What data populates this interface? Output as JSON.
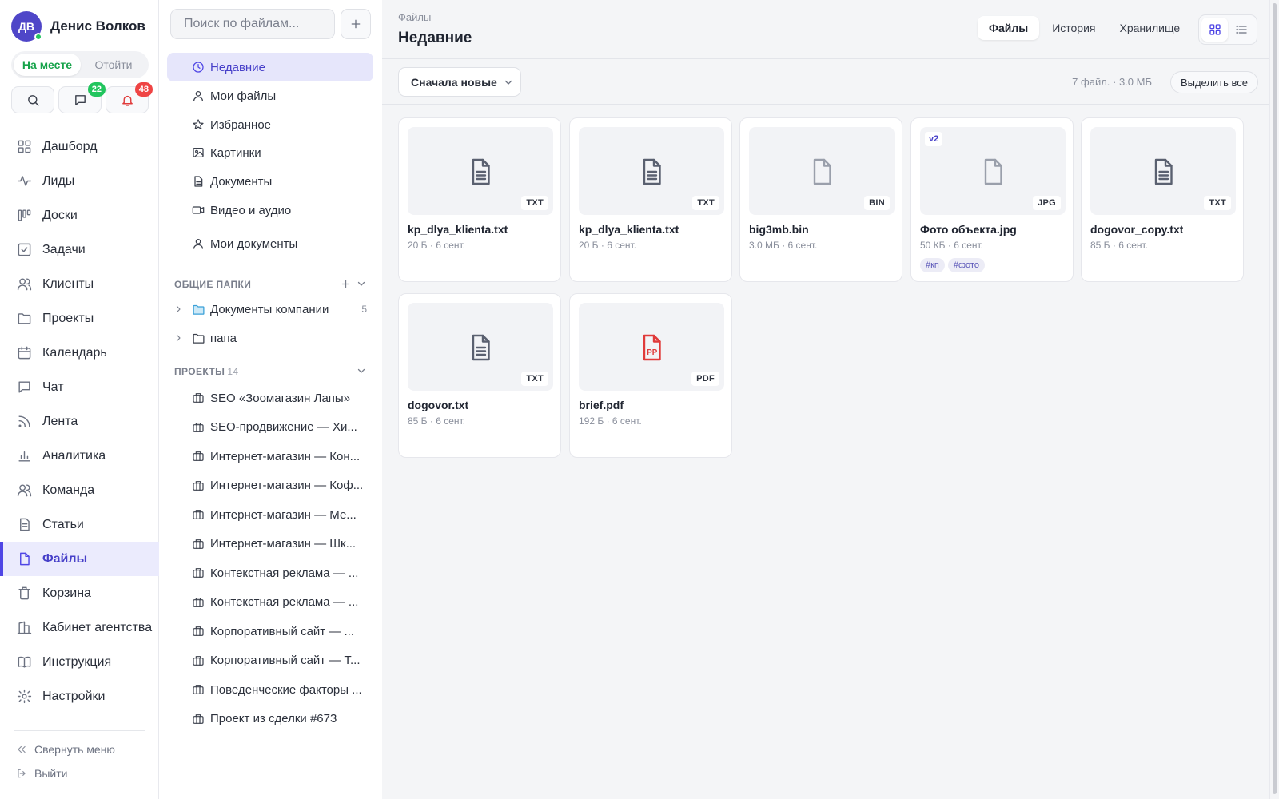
{
  "user": {
    "initials": "ДВ",
    "name": "Денис Волков"
  },
  "presence": {
    "on": "На месте",
    "off": "Отойти"
  },
  "quick": {
    "messages_count": "22",
    "notifications_count": "48"
  },
  "nav": {
    "items": [
      {
        "label": "Дашборд",
        "icon": "grid-icon"
      },
      {
        "label": "Лиды",
        "icon": "activity-icon"
      },
      {
        "label": "Доски",
        "icon": "kanban-icon"
      },
      {
        "label": "Задачи",
        "icon": "checkbox-icon"
      },
      {
        "label": "Клиенты",
        "icon": "users-icon"
      },
      {
        "label": "Проекты",
        "icon": "folder-icon"
      },
      {
        "label": "Календарь",
        "icon": "calendar-icon"
      },
      {
        "label": "Чат",
        "icon": "chat-icon"
      },
      {
        "label": "Лента",
        "icon": "rss-icon"
      },
      {
        "label": "Аналитика",
        "icon": "bar-chart-icon"
      },
      {
        "label": "Команда",
        "icon": "team-icon"
      },
      {
        "label": "Статьи",
        "icon": "article-icon"
      },
      {
        "label": "Файлы",
        "icon": "file-icon"
      },
      {
        "label": "Корзина",
        "icon": "trash-icon"
      },
      {
        "label": "Кабинет агентства",
        "icon": "building-icon"
      },
      {
        "label": "Инструкция",
        "icon": "book-icon"
      },
      {
        "label": "Настройки",
        "icon": "gear-icon"
      }
    ],
    "active_index": 12,
    "collapse": "Свернуть меню",
    "logout": "Выйти"
  },
  "folders": {
    "search_placeholder": "Поиск по файлам...",
    "quick_items": [
      {
        "label": "Недавние",
        "icon": "clock-icon"
      },
      {
        "label": "Мои файлы",
        "icon": "user-icon"
      },
      {
        "label": "Избранное",
        "icon": "star-icon"
      },
      {
        "label": "Картинки",
        "icon": "image-icon"
      },
      {
        "label": "Документы",
        "icon": "document-icon"
      },
      {
        "label": "Видео и аудио",
        "icon": "video-icon"
      }
    ],
    "my_docs": "Мои документы",
    "shared_title": "ОБЩИЕ ПАПКИ",
    "shared": [
      {
        "label": "Документы компании",
        "count": "5"
      },
      {
        "label": "папа",
        "count": ""
      }
    ],
    "projects_title": "ПРОЕКТЫ",
    "projects_count": "14",
    "projects": [
      "SEO «Зоомагазин Лапы»",
      "SEO-продвижение — Хи...",
      "Интернет-магазин — Кон...",
      "Интернет-магазин — Коф...",
      "Интернет-магазин — Ме...",
      "Интернет-магазин — Шк...",
      "Контекстная реклама — ...",
      "Контекстная реклама — ...",
      "Корпоративный сайт — ...",
      "Корпоративный сайт — Т...",
      "Поведенческие факторы ...",
      "Проект из сделки #673"
    ]
  },
  "main": {
    "breadcrumb": "Файлы",
    "title": "Недавние",
    "tabs": [
      "Файлы",
      "История",
      "Хранилище"
    ],
    "sort": "Сначала новые",
    "summary": "7 файл. · 3.0 МБ",
    "select_all": "Выделить все"
  },
  "files": [
    {
      "name": "kp_dlya_klienta.txt",
      "meta": "20 Б · 6 сент.",
      "ext": "TXT",
      "kind": "text",
      "version": "",
      "tags": []
    },
    {
      "name": "kp_dlya_klienta.txt",
      "meta": "20 Б · 6 сент.",
      "ext": "TXT",
      "kind": "text",
      "version": "",
      "tags": []
    },
    {
      "name": "big3mb.bin",
      "meta": "3.0 МБ · 6 сент.",
      "ext": "BIN",
      "kind": "blank",
      "version": "",
      "tags": []
    },
    {
      "name": "Фото объекта.jpg",
      "meta": "50 КБ · 6 сент.",
      "ext": "JPG",
      "kind": "blank",
      "version": "v2",
      "tags": [
        "#кп",
        "#фото"
      ]
    },
    {
      "name": "dogovor_copy.txt",
      "meta": "85 Б · 6 сент.",
      "ext": "TXT",
      "kind": "text",
      "version": "",
      "tags": []
    },
    {
      "name": "dogovor.txt",
      "meta": "85 Б · 6 сент.",
      "ext": "TXT",
      "kind": "text",
      "version": "",
      "tags": []
    },
    {
      "name": "brief.pdf",
      "meta": "192 Б · 6 сент.",
      "ext": "PDF",
      "kind": "pdf",
      "version": "",
      "tags": []
    }
  ],
  "colors": {
    "accent": "#4f46e5",
    "online": "#22c55e",
    "badge_messages": "#22c55e",
    "badge_notifications": "#ef4444",
    "pdf": "#e03a3a"
  }
}
